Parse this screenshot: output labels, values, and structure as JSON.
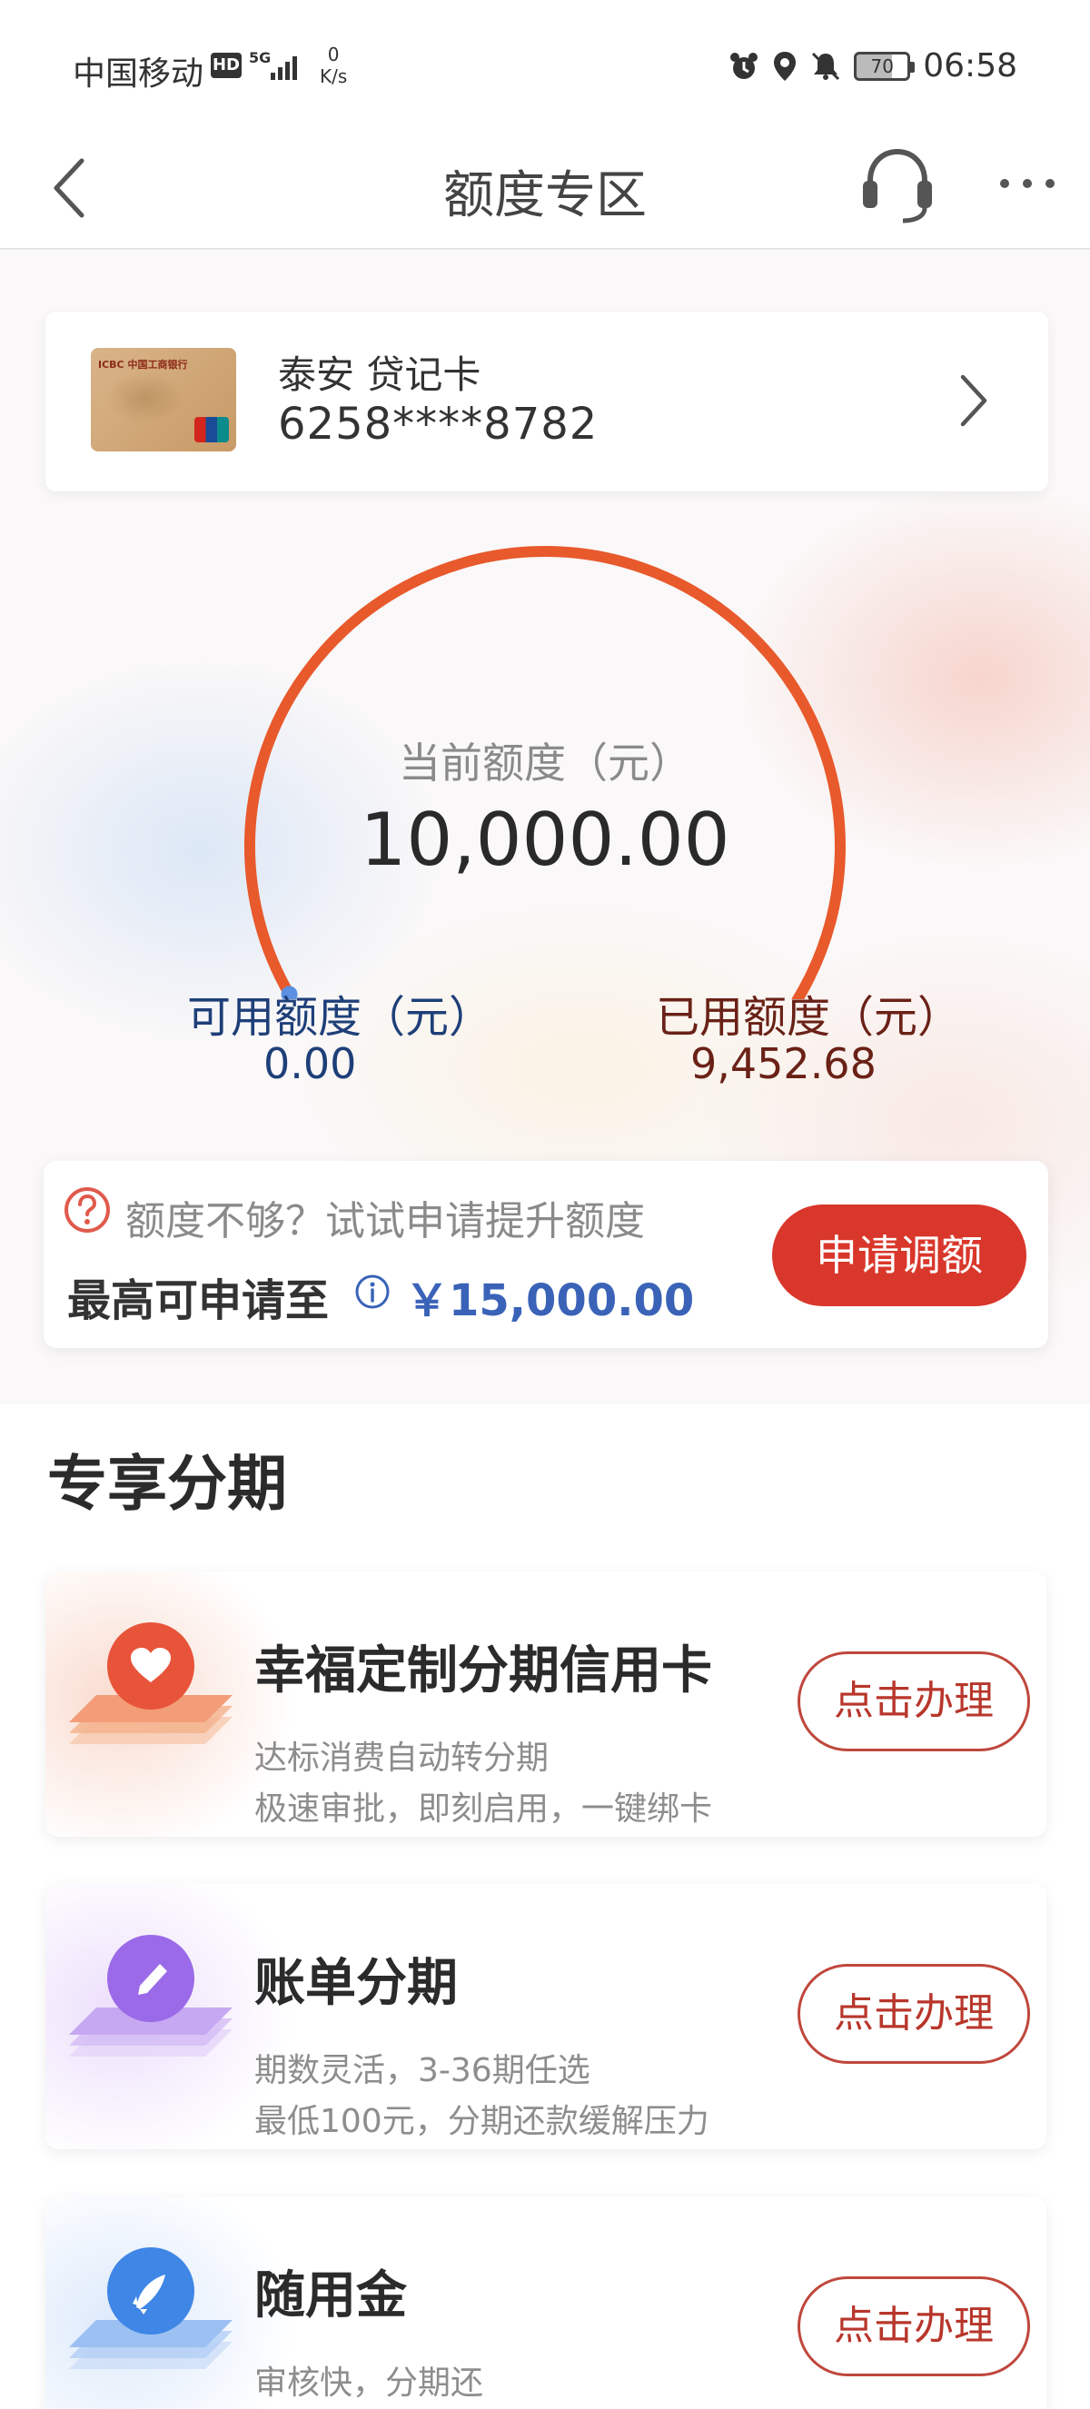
{
  "status_bar": {
    "carrier": "中国移动",
    "hd": "HD",
    "network_gen": "5G",
    "net_speed_value": "0",
    "net_speed_unit": "K/s",
    "battery": "70",
    "time": "06:58"
  },
  "nav": {
    "title": "额度专区"
  },
  "card": {
    "name": "泰安 贷记卡",
    "number": "6258****8782",
    "image_label": "ICBC 中国工商银行"
  },
  "credit": {
    "current_label": "当前额度（元）",
    "current_value": "10,000.00",
    "available_label": "可用额度（元）",
    "available_value": "0.00",
    "used_label": "已用额度（元）",
    "used_value": "9,452.68",
    "gauge_used_fraction": 0.9453,
    "gauge_color": "#e8592c",
    "gauge_dot_color": "#5b8fe0"
  },
  "raise": {
    "prompt": "额度不够？试试申请提升额度",
    "max_label": "最高可申请至",
    "max_amount": "￥15,000.00",
    "button": "申请调额"
  },
  "section": {
    "title": "专享分期"
  },
  "plans": [
    {
      "name": "幸福定制分期信用卡",
      "desc1": "达标消费自动转分期",
      "desc2": "极速审批，即刻启用，一键绑卡",
      "button": "点击办理",
      "icon": "heart-icon",
      "color": "#e8543a"
    },
    {
      "name": "账单分期",
      "desc1": "期数灵活，3-36期任选",
      "desc2": "最低100元，分期还款缓解压力",
      "button": "点击办理",
      "icon": "pen-icon",
      "color": "#9b6ae8"
    },
    {
      "name": "随用金",
      "desc1": "审核快，分期还",
      "desc2": "",
      "button": "点击办理",
      "icon": "rocket-icon",
      "color": "#3f86e6"
    }
  ]
}
